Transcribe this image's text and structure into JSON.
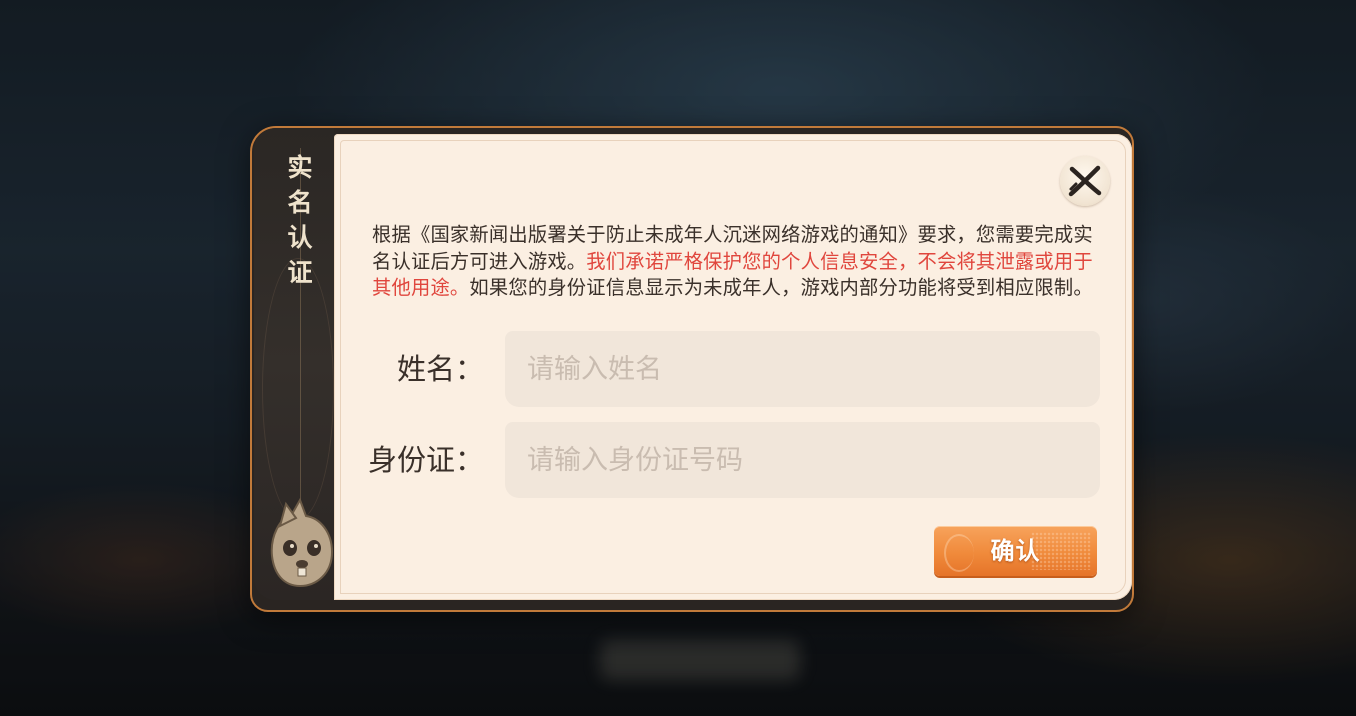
{
  "dialog": {
    "side_title": "实名认证",
    "notice": {
      "part1": "根据《国家新闻出版署关于防止未成年人沉迷网络游戏的通知》要求，您需要完成实名认证后方可进入游戏。",
      "part2_highlight": "我们承诺严格保护您的个人信息安全，不会将其泄露或用于其他用途。",
      "part3": "如果您的身份证信息显示为未成年人，游戏内部分功能将受到相应限制。"
    },
    "name_field": {
      "label": "姓名：",
      "placeholder": "请输入姓名",
      "value": ""
    },
    "id_field": {
      "label": "身份证：",
      "placeholder": "请输入身份证号码",
      "value": ""
    },
    "confirm_label": "确认",
    "close_icon": "close-x-icon",
    "mascot_icon": "squirrel-mascot-icon"
  },
  "colors": {
    "accent_orange": "#f08a3b",
    "highlight_red": "#e0463d",
    "panel_bg": "#fbefe2",
    "tab_bg": "#2b2724"
  }
}
